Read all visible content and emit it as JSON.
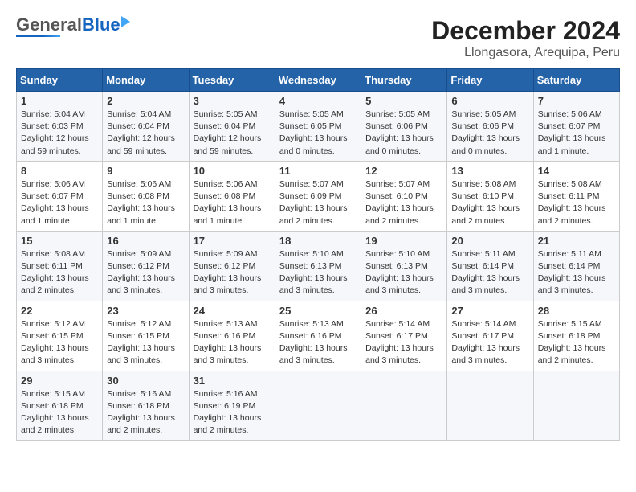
{
  "header": {
    "logo_general": "General",
    "logo_blue": "Blue",
    "title": "December 2024",
    "subtitle": "Llongasora, Arequipa, Peru"
  },
  "calendar": {
    "days_of_week": [
      "Sunday",
      "Monday",
      "Tuesday",
      "Wednesday",
      "Thursday",
      "Friday",
      "Saturday"
    ],
    "weeks": [
      [
        {
          "day": "",
          "info": ""
        },
        {
          "day": "2",
          "info": "Sunrise: 5:04 AM\nSunset: 6:04 PM\nDaylight: 12 hours\nand 59 minutes."
        },
        {
          "day": "3",
          "info": "Sunrise: 5:05 AM\nSunset: 6:04 PM\nDaylight: 12 hours\nand 59 minutes."
        },
        {
          "day": "4",
          "info": "Sunrise: 5:05 AM\nSunset: 6:05 PM\nDaylight: 13 hours\nand 0 minutes."
        },
        {
          "day": "5",
          "info": "Sunrise: 5:05 AM\nSunset: 6:06 PM\nDaylight: 13 hours\nand 0 minutes."
        },
        {
          "day": "6",
          "info": "Sunrise: 5:05 AM\nSunset: 6:06 PM\nDaylight: 13 hours\nand 0 minutes."
        },
        {
          "day": "7",
          "info": "Sunrise: 5:06 AM\nSunset: 6:07 PM\nDaylight: 13 hours\nand 1 minute."
        }
      ],
      [
        {
          "day": "8",
          "info": "Sunrise: 5:06 AM\nSunset: 6:07 PM\nDaylight: 13 hours\nand 1 minute."
        },
        {
          "day": "9",
          "info": "Sunrise: 5:06 AM\nSunset: 6:08 PM\nDaylight: 13 hours\nand 1 minute."
        },
        {
          "day": "10",
          "info": "Sunrise: 5:06 AM\nSunset: 6:08 PM\nDaylight: 13 hours\nand 1 minute."
        },
        {
          "day": "11",
          "info": "Sunrise: 5:07 AM\nSunset: 6:09 PM\nDaylight: 13 hours\nand 2 minutes."
        },
        {
          "day": "12",
          "info": "Sunrise: 5:07 AM\nSunset: 6:10 PM\nDaylight: 13 hours\nand 2 minutes."
        },
        {
          "day": "13",
          "info": "Sunrise: 5:08 AM\nSunset: 6:10 PM\nDaylight: 13 hours\nand 2 minutes."
        },
        {
          "day": "14",
          "info": "Sunrise: 5:08 AM\nSunset: 6:11 PM\nDaylight: 13 hours\nand 2 minutes."
        }
      ],
      [
        {
          "day": "15",
          "info": "Sunrise: 5:08 AM\nSunset: 6:11 PM\nDaylight: 13 hours\nand 2 minutes."
        },
        {
          "day": "16",
          "info": "Sunrise: 5:09 AM\nSunset: 6:12 PM\nDaylight: 13 hours\nand 3 minutes."
        },
        {
          "day": "17",
          "info": "Sunrise: 5:09 AM\nSunset: 6:12 PM\nDaylight: 13 hours\nand 3 minutes."
        },
        {
          "day": "18",
          "info": "Sunrise: 5:10 AM\nSunset: 6:13 PM\nDaylight: 13 hours\nand 3 minutes."
        },
        {
          "day": "19",
          "info": "Sunrise: 5:10 AM\nSunset: 6:13 PM\nDaylight: 13 hours\nand 3 minutes."
        },
        {
          "day": "20",
          "info": "Sunrise: 5:11 AM\nSunset: 6:14 PM\nDaylight: 13 hours\nand 3 minutes."
        },
        {
          "day": "21",
          "info": "Sunrise: 5:11 AM\nSunset: 6:14 PM\nDaylight: 13 hours\nand 3 minutes."
        }
      ],
      [
        {
          "day": "22",
          "info": "Sunrise: 5:12 AM\nSunset: 6:15 PM\nDaylight: 13 hours\nand 3 minutes."
        },
        {
          "day": "23",
          "info": "Sunrise: 5:12 AM\nSunset: 6:15 PM\nDaylight: 13 hours\nand 3 minutes."
        },
        {
          "day": "24",
          "info": "Sunrise: 5:13 AM\nSunset: 6:16 PM\nDaylight: 13 hours\nand 3 minutes."
        },
        {
          "day": "25",
          "info": "Sunrise: 5:13 AM\nSunset: 6:16 PM\nDaylight: 13 hours\nand 3 minutes."
        },
        {
          "day": "26",
          "info": "Sunrise: 5:14 AM\nSunset: 6:17 PM\nDaylight: 13 hours\nand 3 minutes."
        },
        {
          "day": "27",
          "info": "Sunrise: 5:14 AM\nSunset: 6:17 PM\nDaylight: 13 hours\nand 3 minutes."
        },
        {
          "day": "28",
          "info": "Sunrise: 5:15 AM\nSunset: 6:18 PM\nDaylight: 13 hours\nand 2 minutes."
        }
      ],
      [
        {
          "day": "29",
          "info": "Sunrise: 5:15 AM\nSunset: 6:18 PM\nDaylight: 13 hours\nand 2 minutes."
        },
        {
          "day": "30",
          "info": "Sunrise: 5:16 AM\nSunset: 6:18 PM\nDaylight: 13 hours\nand 2 minutes."
        },
        {
          "day": "31",
          "info": "Sunrise: 5:16 AM\nSunset: 6:19 PM\nDaylight: 13 hours\nand 2 minutes."
        },
        {
          "day": "",
          "info": ""
        },
        {
          "day": "",
          "info": ""
        },
        {
          "day": "",
          "info": ""
        },
        {
          "day": "",
          "info": ""
        }
      ]
    ],
    "week1_day1": {
      "day": "1",
      "info": "Sunrise: 5:04 AM\nSunset: 6:03 PM\nDaylight: 12 hours\nand 59 minutes."
    }
  }
}
